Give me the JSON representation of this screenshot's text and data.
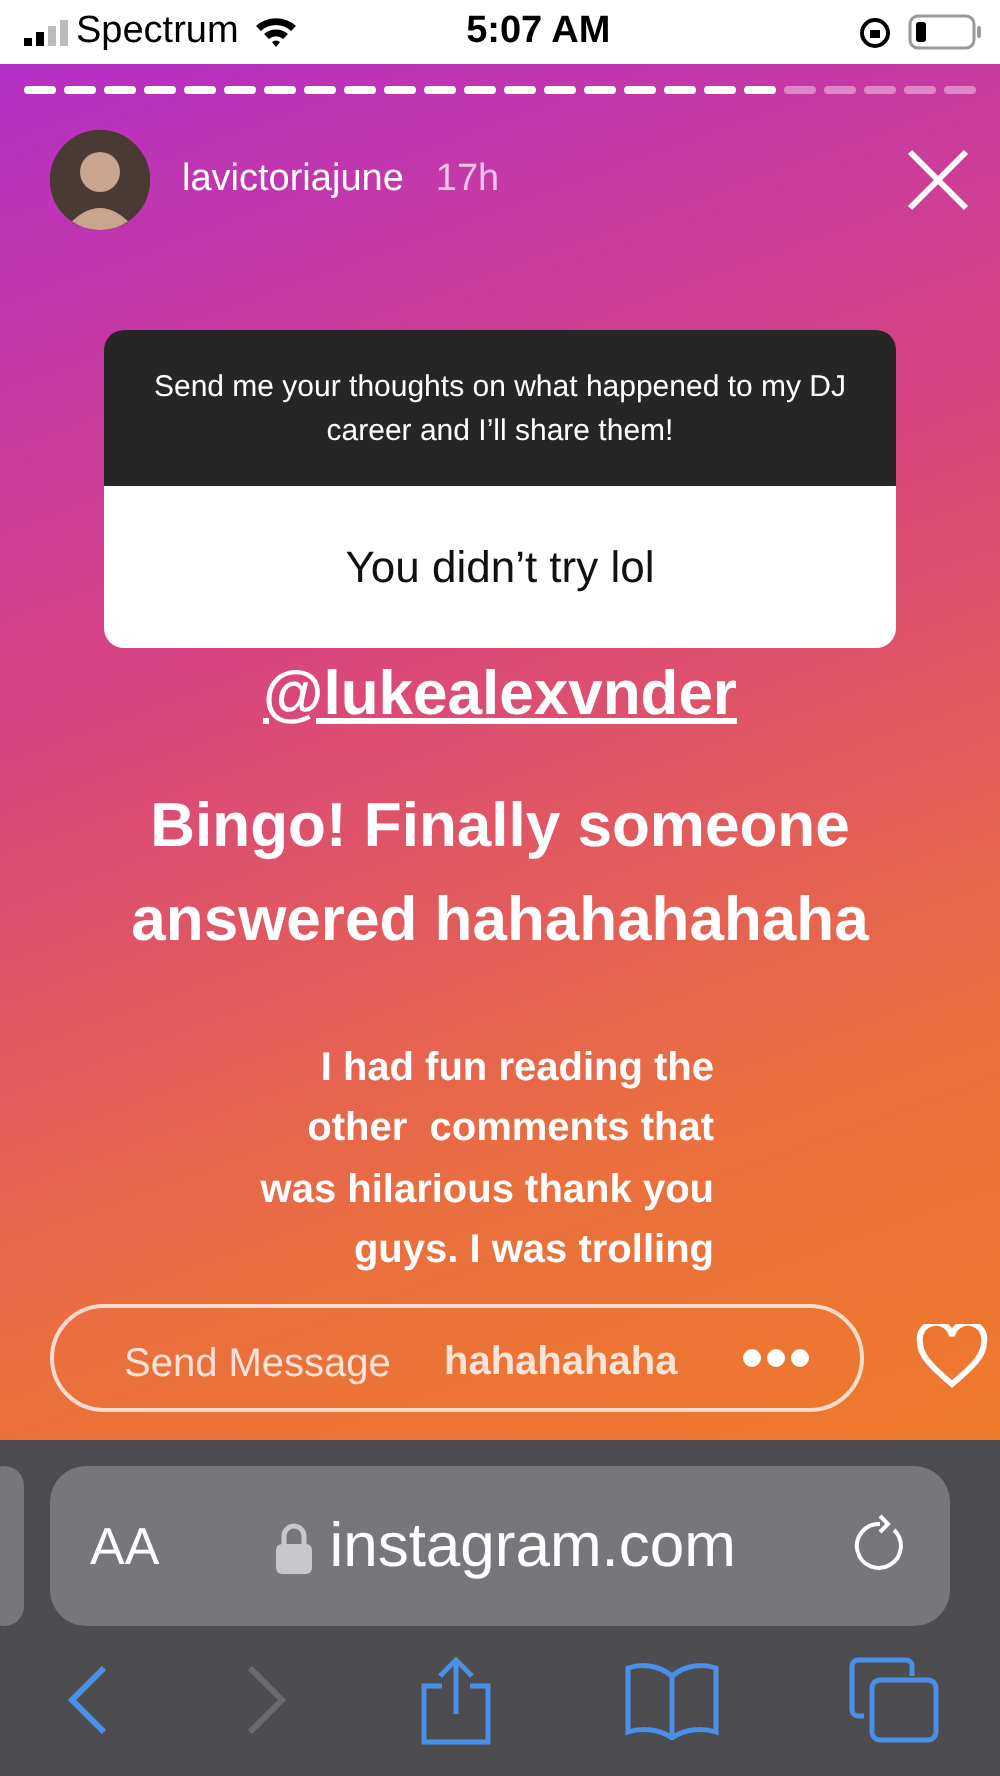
{
  "status_bar": {
    "carrier": "Spectrum",
    "time": "5:07 AM"
  },
  "story": {
    "progress": [
      {
        "viewed": true
      },
      {
        "viewed": true
      },
      {
        "viewed": true
      },
      {
        "viewed": true
      },
      {
        "viewed": true
      },
      {
        "viewed": true
      },
      {
        "viewed": true
      },
      {
        "viewed": true
      },
      {
        "viewed": true
      },
      {
        "viewed": true
      },
      {
        "viewed": true
      },
      {
        "viewed": true
      },
      {
        "viewed": true
      },
      {
        "viewed": true
      },
      {
        "viewed": true
      },
      {
        "viewed": true
      },
      {
        "viewed": true
      },
      {
        "viewed": true
      },
      {
        "viewed": true
      },
      {
        "viewed": false
      },
      {
        "viewed": false
      },
      {
        "viewed": false
      },
      {
        "viewed": false
      },
      {
        "viewed": false
      }
    ],
    "username": "lavictoriajune",
    "age": "17h",
    "question": {
      "prompt": "Send me your thoughts on what happened to my DJ career and I’ll share them!",
      "answer": "You didn’t try lol"
    },
    "mention": "@lukealexvnder",
    "headline": "Bingo! Finally someone answered hahahahahaha",
    "caption_lines": [
      "I had fun reading the",
      "other  comments that",
      "was hilarious thank you",
      "guys. I was trolling"
    ],
    "message_field": {
      "placeholder": "Send Message",
      "overlay_text": "hahahahaha"
    }
  },
  "browser": {
    "aa_label": "AA",
    "url": "instagram.com"
  }
}
